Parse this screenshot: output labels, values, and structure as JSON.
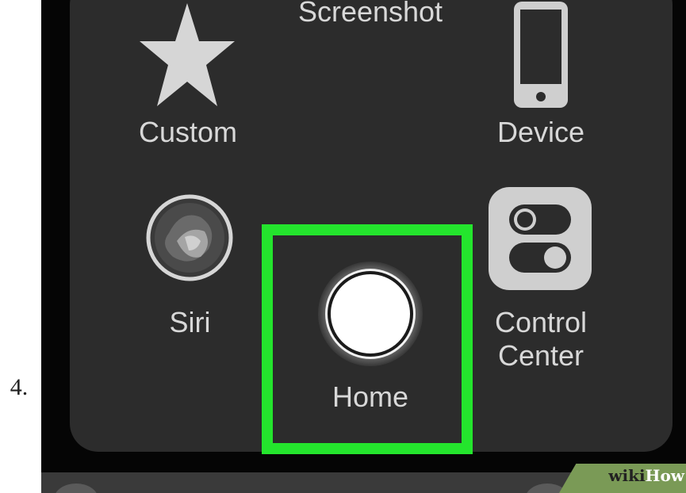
{
  "step_number": "4.",
  "menu": {
    "items": [
      {
        "label": "Screenshot",
        "icon": "camera-icon"
      },
      {
        "label": "Custom",
        "icon": "star-icon"
      },
      {
        "label": "Device",
        "icon": "phone-icon"
      },
      {
        "label": "Siri",
        "icon": "siri-icon"
      },
      {
        "label": "Home",
        "icon": "home-button-icon"
      },
      {
        "label": "Control Center",
        "icon": "toggles-icon"
      }
    ]
  },
  "highlight_color": "#24e52d",
  "watermark": {
    "part1": "wiki",
    "part2": "How"
  }
}
